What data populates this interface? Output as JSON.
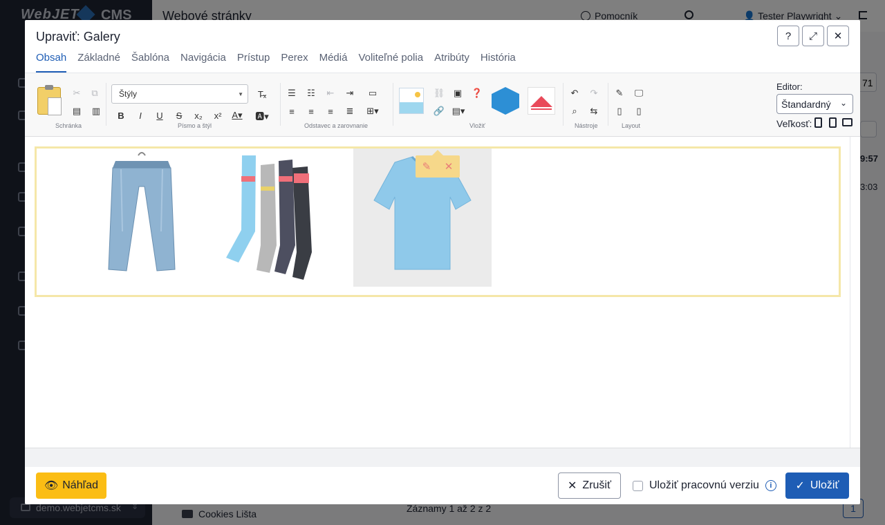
{
  "background": {
    "logo": "WebJET",
    "logo_cms": "CMS",
    "page_title": "Webové stránky",
    "help_label": "Pomocník",
    "user_name": "Tester Playwright",
    "domain": "demo.webjetcms.sk",
    "tree_item": "Cookies Lišta",
    "records_text": "Záznamy 1 až 2 z 2",
    "page_number": "1",
    "right_num1": "71",
    "right_num2": "9:57",
    "right_num3": "3:03"
  },
  "modal": {
    "title": "Upraviť: Galery",
    "tabs": [
      "Obsah",
      "Základné",
      "Šablóna",
      "Navigácia",
      "Prístup",
      "Perex",
      "Médiá",
      "Voliteľné polia",
      "Atribúty",
      "História"
    ],
    "active_tab": "Obsah"
  },
  "toolbar": {
    "groups": {
      "clipboard": "Schránka",
      "font": "Písmo a štýl",
      "paragraph": "Odstavec a zarovnanie",
      "insert": "Vložiť",
      "tools": "Nástroje",
      "layout": "Layout"
    },
    "styles_placeholder": "Štýly",
    "editor_label": "Editor:",
    "editor_value": "Štandardný",
    "size_label": "Veľkosť:"
  },
  "gallery": {
    "items": [
      {
        "name": "jeans",
        "color": "#8fb3d1"
      },
      {
        "name": "socks",
        "color": "#b7c4d8"
      },
      {
        "name": "tshirt",
        "color": "#8fc9ea"
      }
    ]
  },
  "footer": {
    "preview_label": "Náhľad",
    "cancel_label": "Zrušiť",
    "save_work_label": "Uložiť pracovnú verziu",
    "save_label": "Uložiť"
  },
  "colors": {
    "accent": "#1e5db5",
    "preview_button": "#fbbd14",
    "gallery_border": "#f5e7a8"
  }
}
